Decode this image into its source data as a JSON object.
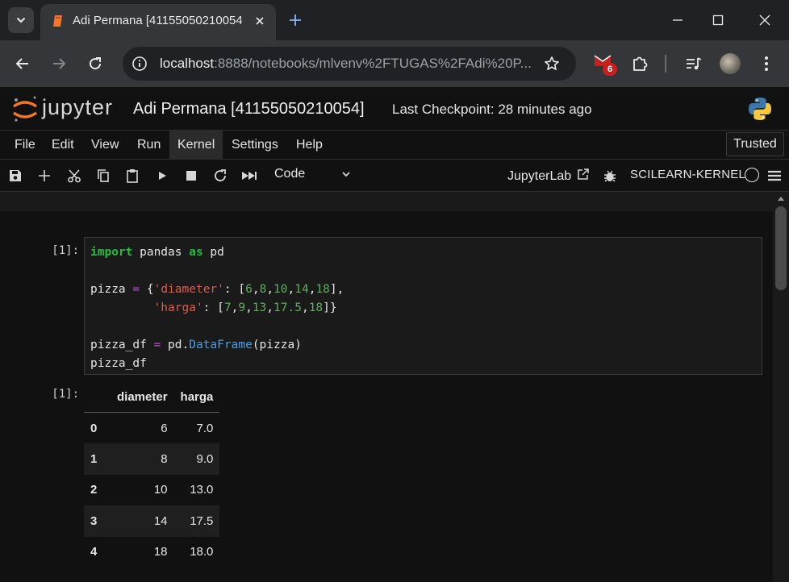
{
  "browser": {
    "tab_title": "Adi Permana [41155050210054]",
    "url_host": "localhost",
    "url_path": ":8888/notebooks/mlvenv%2FTUGAS%2FAdi%20P...",
    "gmail_badge": "6"
  },
  "jupyter": {
    "logo_text": "jupyter",
    "notebook_title": "Adi Permana [41155050210054]",
    "checkpoint": "Last Checkpoint: 28 minutes ago",
    "menu": [
      "File",
      "Edit",
      "View",
      "Run",
      "Kernel",
      "Settings",
      "Help"
    ],
    "active_menu": "Kernel",
    "trusted": "Trusted",
    "cell_type": "Code",
    "jupyterlab_link": "JupyterLab",
    "kernel_name": "SCILEARN-KERNEL"
  },
  "cells": {
    "input_prompt": "[1]:",
    "output_prompt": "[1]:",
    "code_lines": [
      "import pandas as pd",
      "",
      "pizza = {'diameter': [6,8,10,14,18],",
      "         'harga': [7,9,13,17.5,18]}",
      "",
      "pizza_df = pd.DataFrame(pizza)",
      "pizza_df"
    ]
  },
  "dataframe": {
    "columns": [
      "diameter",
      "harga"
    ],
    "rows": [
      {
        "index": "0",
        "diameter": "6",
        "harga": "7.0"
      },
      {
        "index": "1",
        "diameter": "8",
        "harga": "9.0"
      },
      {
        "index": "2",
        "diameter": "10",
        "harga": "13.0"
      },
      {
        "index": "3",
        "diameter": "14",
        "harga": "17.5"
      },
      {
        "index": "4",
        "diameter": "18",
        "harga": "18.0"
      }
    ]
  }
}
